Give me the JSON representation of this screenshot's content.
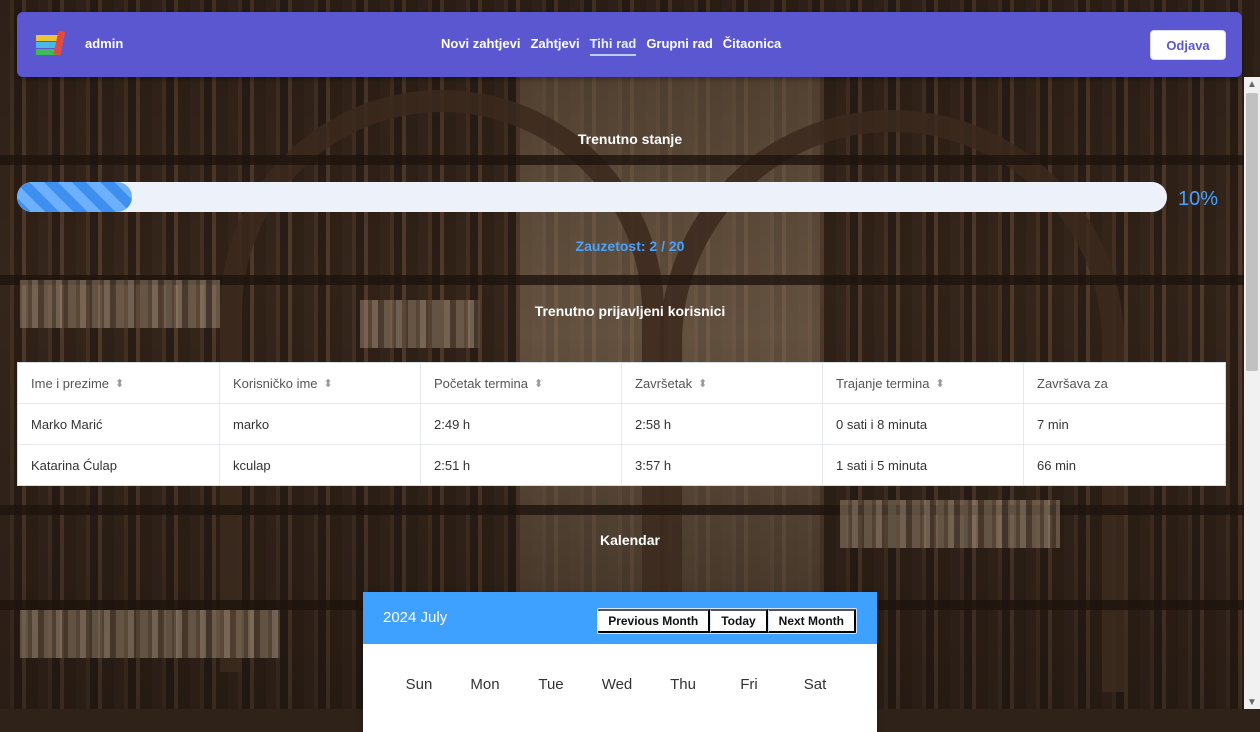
{
  "nav": {
    "brand": "admin",
    "links": [
      "Novi zahtjevi",
      "Zahtjevi",
      "Tihi rad",
      "Grupni rad",
      "Čitaonica"
    ],
    "active_index": 2,
    "logout_label": "Odjava"
  },
  "status": {
    "title": "Trenutno stanje",
    "progress_percent": 10,
    "progress_label": "10%",
    "occupancy_label": "Zauzetost: 2 / 20"
  },
  "users": {
    "title": "Trenutno prijavljeni korisnici",
    "columns": [
      {
        "label": "Ime i prezime",
        "sortable": true
      },
      {
        "label": "Korisničko ime",
        "sortable": true
      },
      {
        "label": "Početak termina",
        "sortable": true
      },
      {
        "label": "Završetak",
        "sortable": true
      },
      {
        "label": "Trajanje termina",
        "sortable": true
      },
      {
        "label": "Završava za",
        "sortable": false
      }
    ],
    "rows": [
      [
        "Marko Marić",
        "marko",
        "2:49 h",
        "2:58 h",
        "0 sati i 8 minuta",
        "7 min"
      ],
      [
        "Katarina Ćulap",
        "kculap",
        "2:51 h",
        "3:57 h",
        "1 sati i 5 minuta",
        "66 min"
      ]
    ]
  },
  "calendar": {
    "title": "Kalendar",
    "month_label": "2024 July",
    "buttons": {
      "prev": "Previous Month",
      "today": "Today",
      "next": "Next Month"
    },
    "days": [
      "Sun",
      "Mon",
      "Tue",
      "Wed",
      "Thu",
      "Fri",
      "Sat"
    ]
  },
  "colors": {
    "navbar": "#5b57d1",
    "accent": "#46a3ff",
    "calendar_header": "#3ea0ff"
  }
}
